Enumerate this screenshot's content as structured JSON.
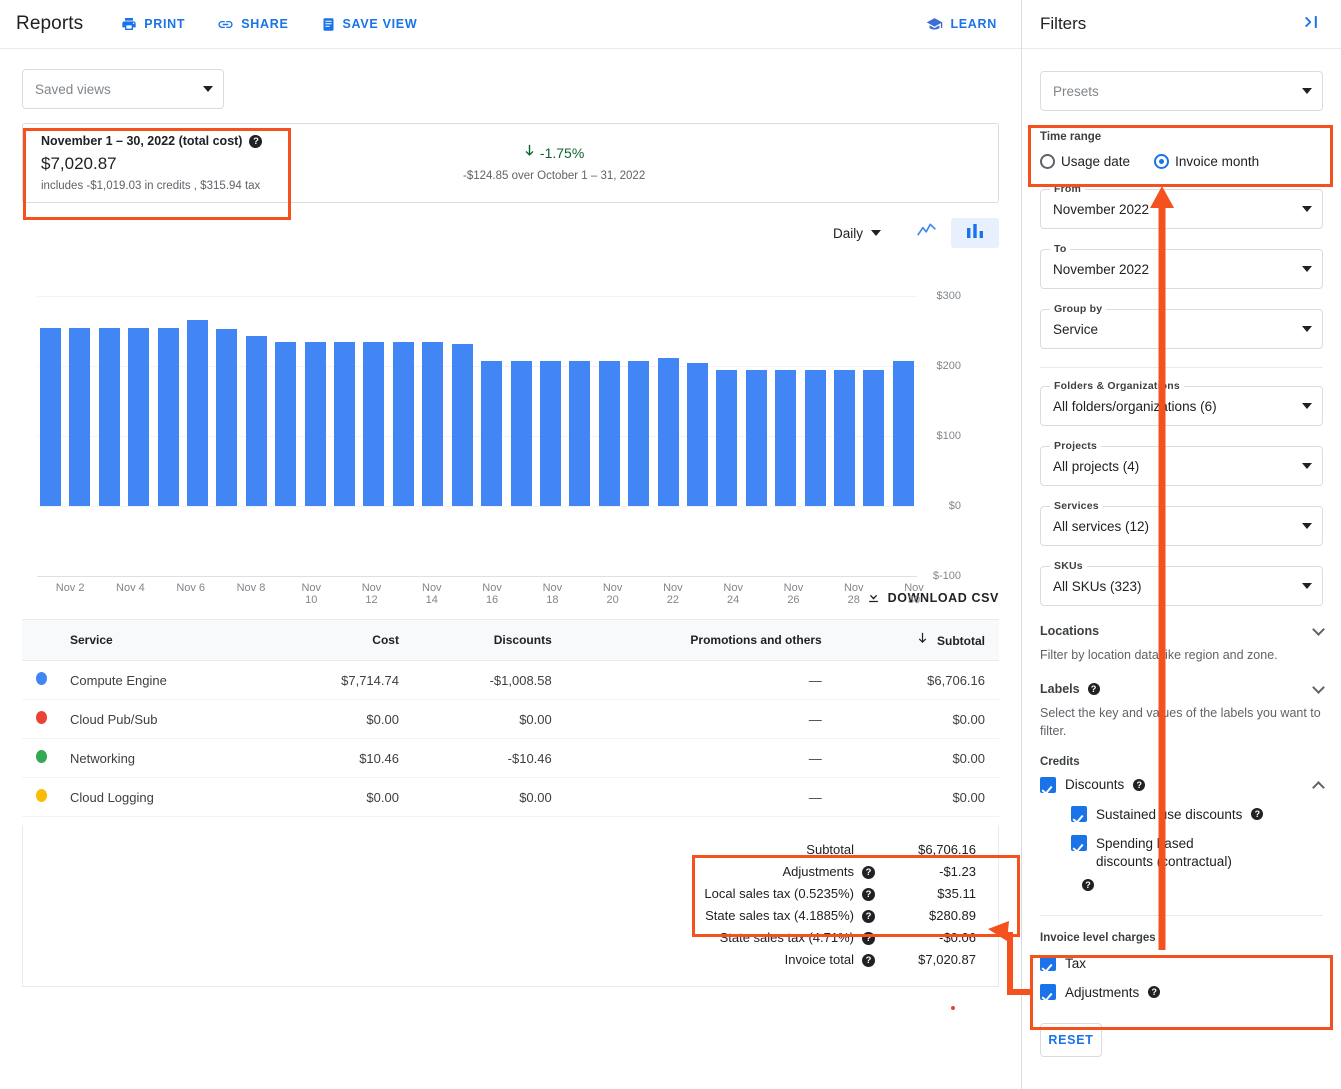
{
  "header": {
    "title": "Reports",
    "actions": [
      {
        "label": "PRINT",
        "icon": "printer-icon"
      },
      {
        "label": "SHARE",
        "icon": "link-icon"
      },
      {
        "label": "SAVE VIEW",
        "icon": "document-icon"
      }
    ],
    "learn": {
      "label": "LEARN",
      "icon": "graduation-cap-icon"
    }
  },
  "saved_views": {
    "placeholder": "Saved views"
  },
  "summary": {
    "date_label": "November 1 – 30, 2022 (total cost)",
    "amount": "$7,020.87",
    "includes": "includes -$1,019.03 in credits , $315.94 tax",
    "change_pct": "-1.75%",
    "change_direction": "down",
    "change_sub": "-$124.85 over October 1 – 31, 2022",
    "change_color": "#0d652d"
  },
  "chart_controls": {
    "granularity": "Daily",
    "line_view_icon": "line-chart-icon",
    "bar_view_icon": "bar-chart-icon",
    "active_view": "bar"
  },
  "chart_data": {
    "type": "bar",
    "title": "",
    "xlabel": "",
    "ylabel": "",
    "ylim": [
      -100,
      300
    ],
    "grid": true,
    "yticks": [
      "$300",
      "$200",
      "$100",
      "$0",
      "$-100"
    ],
    "ytick_values": [
      300,
      200,
      100,
      0,
      -100
    ],
    "bar_color": "#4285f4",
    "x": [
      "Nov 1",
      "Nov 2",
      "Nov 3",
      "Nov 4",
      "Nov 5",
      "Nov 6",
      "Nov 7",
      "Nov 8",
      "Nov 9",
      "Nov 10",
      "Nov 11",
      "Nov 12",
      "Nov 13",
      "Nov 14",
      "Nov 15",
      "Nov 16",
      "Nov 17",
      "Nov 18",
      "Nov 19",
      "Nov 20",
      "Nov 21",
      "Nov 22",
      "Nov 23",
      "Nov 24",
      "Nov 25",
      "Nov 26",
      "Nov 27",
      "Nov 28",
      "Nov 29",
      "Nov 30"
    ],
    "xtick_labels": [
      "Nov 2",
      "Nov 4",
      "Nov 6",
      "Nov 8",
      "Nov 10",
      "Nov 12",
      "Nov 14",
      "Nov 16",
      "Nov 18",
      "Nov 20",
      "Nov 22",
      "Nov 24",
      "Nov 26",
      "Nov 28",
      "Nov 30"
    ],
    "values": [
      254,
      254,
      254,
      254,
      254,
      266,
      253,
      243,
      234,
      234,
      234,
      234,
      234,
      234,
      231,
      207,
      207,
      207,
      207,
      207,
      207,
      211,
      204,
      195,
      195,
      195,
      195,
      195,
      195,
      207
    ]
  },
  "download": {
    "label": "DOWNLOAD CSV",
    "icon": "download-icon"
  },
  "service_table": {
    "columns": [
      "Service",
      "Cost",
      "Discounts",
      "Promotions and others",
      "Subtotal"
    ],
    "sorted_column": "Subtotal",
    "rows": [
      {
        "service": "Compute Engine",
        "color": "#4285f4",
        "cost": "$7,714.74",
        "discounts": "-$1,008.58",
        "promotions": "—",
        "subtotal": "$6,706.16"
      },
      {
        "service": "Cloud Pub/Sub",
        "color": "#ea4335",
        "cost": "$0.00",
        "discounts": "$0.00",
        "promotions": "—",
        "subtotal": "$0.00"
      },
      {
        "service": "Networking",
        "color": "#34a853",
        "cost": "$10.46",
        "discounts": "-$10.46",
        "promotions": "—",
        "subtotal": "$0.00"
      },
      {
        "service": "Cloud Logging",
        "color": "#fbbc04",
        "cost": "$0.00",
        "discounts": "$0.00",
        "promotions": "—",
        "subtotal": "$0.00"
      }
    ]
  },
  "totals": [
    {
      "label": "Subtotal",
      "value": "$6,706.16",
      "has_help": false,
      "bold": false
    },
    {
      "label": "Adjustments",
      "value": "-$1.23",
      "has_help": true,
      "bold": false
    },
    {
      "label": "Local sales tax (0.5235%)",
      "value": "$35.11",
      "has_help": true,
      "bold": false
    },
    {
      "label": "State sales tax (4.1885%)",
      "value": "$280.89",
      "has_help": true,
      "bold": false
    },
    {
      "label": "State sales tax (4.71%)",
      "value": "-$0.06",
      "has_help": true,
      "bold": false
    },
    {
      "label": "Invoice total",
      "value": "$7,020.87",
      "has_help": true,
      "bold": false
    }
  ],
  "filters": {
    "title": "Filters",
    "collapse_icon": "collapse-panel-icon",
    "presets": {
      "placeholder": "Presets"
    },
    "time_range": {
      "label": "Time range",
      "options": [
        {
          "label": "Usage date",
          "selected": false
        },
        {
          "label": "Invoice month",
          "selected": true
        }
      ]
    },
    "selects": [
      {
        "legend": "From",
        "value": "November 2022"
      },
      {
        "legend": "To",
        "value": "November 2022"
      },
      {
        "legend": "Group by",
        "value": "Service"
      }
    ],
    "scope_selects": [
      {
        "legend": "Folders & Organizations",
        "value": "All folders/organizations (6)"
      },
      {
        "legend": "Projects",
        "value": "All projects (4)"
      },
      {
        "legend": "Services",
        "value": "All services (12)"
      },
      {
        "legend": "SKUs",
        "value": "All SKUs (323)"
      }
    ],
    "locations": {
      "title": "Locations",
      "help": "Filter by location data like region and zone.",
      "expanded": false
    },
    "labels": {
      "title": "Labels",
      "help": "Select the key and values of the labels you want to filter.",
      "expanded": false
    },
    "credits": {
      "title": "Credits",
      "discounts": {
        "label": "Discounts",
        "checked": true,
        "has_help": true
      },
      "children": [
        {
          "label": "Sustained use discounts",
          "checked": true,
          "has_help": true
        },
        {
          "label": "Spending based discounts (contractual)",
          "checked": true,
          "has_help": true
        }
      ]
    },
    "invoice_level_charges": {
      "title": "Invoice level charges",
      "items": [
        {
          "label": "Tax",
          "checked": true,
          "has_help": false
        },
        {
          "label": "Adjustments",
          "checked": true,
          "has_help": true
        }
      ]
    },
    "reset": {
      "label": "RESET"
    }
  },
  "annotation": {
    "color": "#f4511e"
  }
}
